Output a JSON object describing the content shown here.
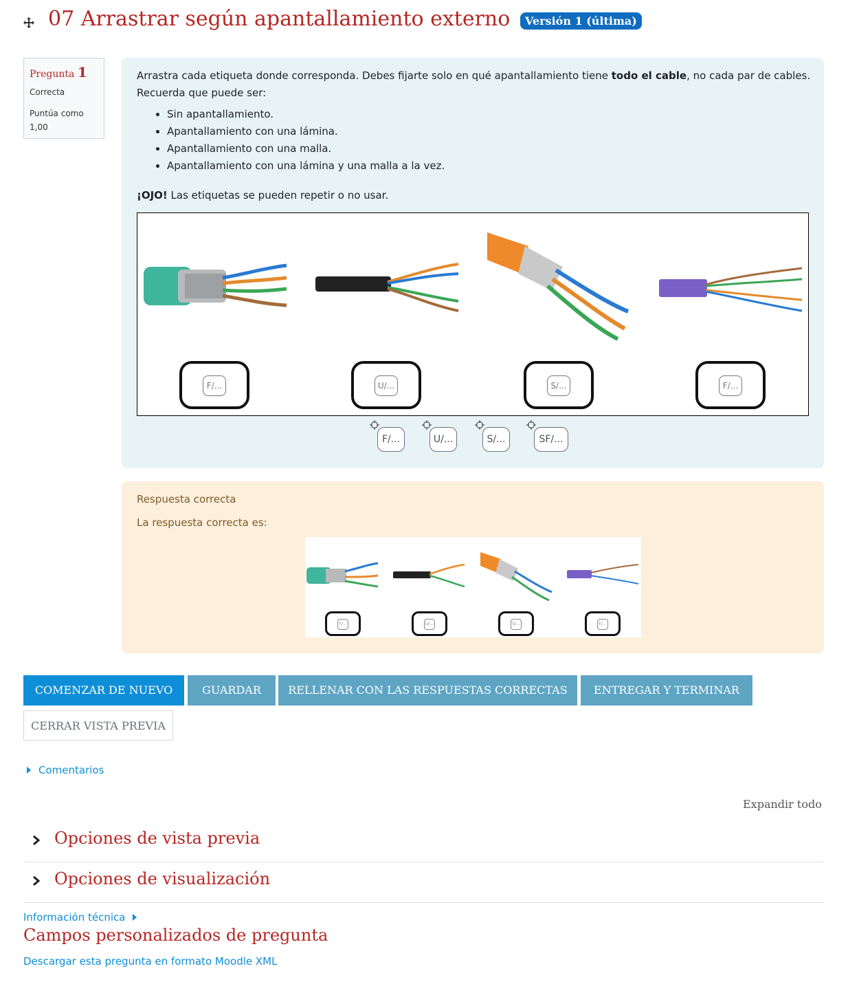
{
  "header": {
    "title": "07 Arrastrar según apantallamiento externo",
    "version_badge": "Versión 1 (última)"
  },
  "info": {
    "question_word": "Pregunta",
    "question_number": "1",
    "state": "Correcta",
    "grade": "Puntúa como 1,00"
  },
  "question": {
    "intro_start": "Arrastra cada etiqueta donde corresponda. Debes fijarte solo en qué apantallamiento tiene ",
    "intro_bold": "todo el cable",
    "intro_end": ", no cada par de cables. Recuerda que puede ser:",
    "options": [
      "Sin apantallamiento.",
      "Apantallamiento con una lámina.",
      "Apantallamiento con una malla.",
      "Apantallamiento con una lámina y una malla a la vez."
    ],
    "warning_bold": "¡OJO!",
    "warning_text": " Las etiquetas se pueden repetir o no usar.",
    "dropzones": [
      "F/...",
      "U/...",
      "S/...",
      "F/..."
    ],
    "drag_items": [
      "F/...",
      "U/...",
      "S/...",
      "SF/..."
    ]
  },
  "feedback": {
    "title": "Respuesta correcta",
    "answer_intro": "La respuesta correcta es:",
    "answers": [
      "F/...",
      "U/...",
      "S/...",
      "F/..."
    ]
  },
  "buttons": {
    "restart": "COMENZAR DE NUEVO",
    "save": "GUARDAR",
    "fill_correct": "RELLENAR CON LAS RESPUESTAS CORRECTAS",
    "submit": "ENTREGAR Y TERMINAR",
    "close_preview": "CERRAR VISTA PREVIA"
  },
  "links": {
    "comments": "Comentarios",
    "expand_all": "Expandir todo",
    "tech_info": "Información técnica",
    "download": "Descargar esta pregunta en formato Moodle XML"
  },
  "sections": {
    "preview_options": "Opciones de vista previa",
    "display_options": "Opciones de visualización",
    "custom_fields": "Campos personalizados de pregunta"
  },
  "colors": {
    "title_red": "#b52623",
    "link_blue": "#0f8ed8",
    "badge_blue": "#0f6cbf",
    "question_bg": "#e7f3f5",
    "feedback_bg": "#fcefdc"
  }
}
